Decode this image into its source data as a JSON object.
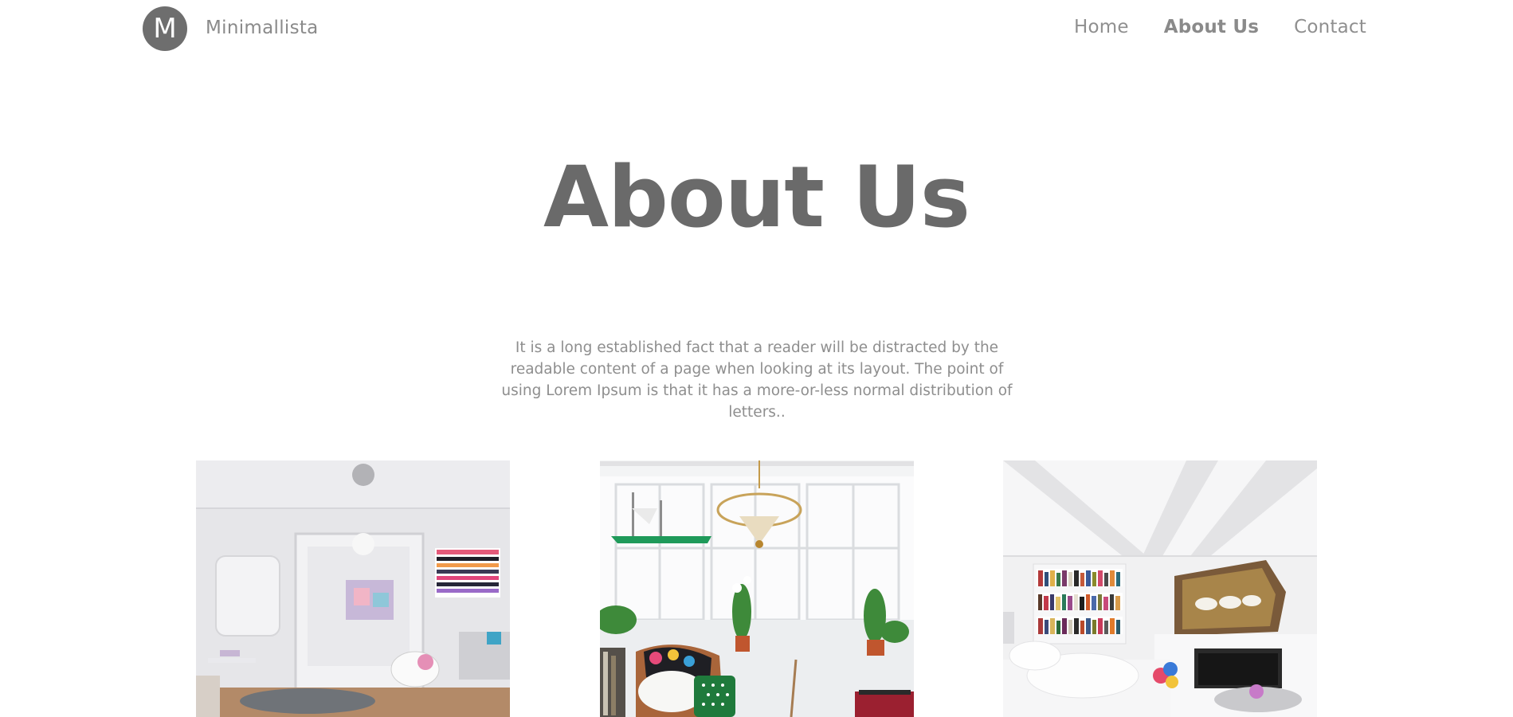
{
  "header": {
    "logo_letter": "M",
    "brand": "Minimallista",
    "nav": [
      {
        "label": "Home",
        "active": false
      },
      {
        "label": "About Us",
        "active": true
      },
      {
        "label": "Contact",
        "active": false
      }
    ]
  },
  "hero": {
    "title": "About Us",
    "intro": "It is a long established fact that a reader will be distracted by the readable content of a page when looking at its layout. The point of using Lorem Ipsum is that it has a more-or-less normal distribution of letters.."
  },
  "colors": {
    "logo_bg": "#6e6e6e",
    "text_primary": "#6a6a6a",
    "text_muted": "#8e8e8e"
  }
}
